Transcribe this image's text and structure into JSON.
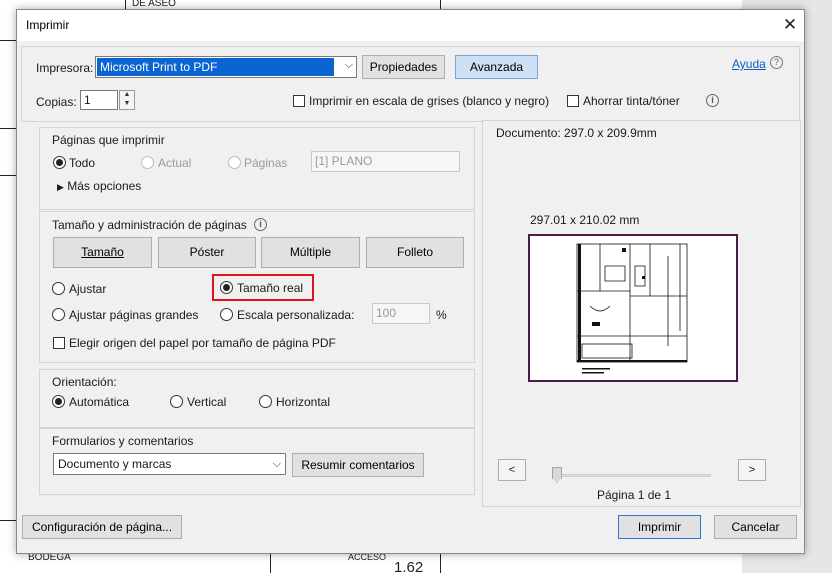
{
  "background": {
    "top_text": "DE ASEO",
    "bottom_left_text": "BODEGA",
    "bottom_mid_text": "ACCESO",
    "bottom_number": "1.62"
  },
  "dialog": {
    "title": "Imprimir",
    "close_glyph": "✕",
    "printer_label": "Impresora:",
    "printer_value": "Microsoft Print to PDF",
    "properties_button": "Propiedades",
    "advanced_button": "Avanzada",
    "help_link": "Ayuda",
    "copies_label": "Copias:",
    "copies_value": "1",
    "grayscale_label": "Imprimir en escala de grises (blanco y negro)",
    "save_ink_label": "Ahorrar tinta/tóner"
  },
  "pages_section": {
    "title": "Páginas que imprimir",
    "all_label": "Todo",
    "current_label": "Actual",
    "pages_label": "Páginas",
    "pages_value": "[1] PLANO",
    "more_options": "Más opciones"
  },
  "sizing_section": {
    "title": "Tamaño y administración de páginas",
    "tabs": [
      "Tamaño",
      "Póster",
      "Múltiple",
      "Folleto"
    ],
    "fit_label": "Ajustar",
    "actual_size_label": "Tamaño real",
    "shrink_label": "Ajustar páginas grandes",
    "custom_scale_label": "Escala personalizada:",
    "custom_scale_value": "100",
    "percent": "%",
    "paper_source_label": "Elegir origen del papel por tamaño de página PDF"
  },
  "orientation_section": {
    "title": "Orientación:",
    "auto_label": "Automática",
    "portrait_label": "Vertical",
    "landscape_label": "Horizontal"
  },
  "forms_section": {
    "title": "Formularios y comentarios",
    "select_value": "Documento y marcas",
    "summarize_button": "Resumir comentarios"
  },
  "preview": {
    "document_size": "Documento: 297.0 x 209.9mm",
    "page_size": "297.01 x 210.02 mm",
    "prev_glyph": "<",
    "next_glyph": ">",
    "page_indicator": "Página 1 de 1"
  },
  "footer": {
    "page_setup_button": "Configuración de página...",
    "print_button": "Imprimir",
    "cancel_button": "Cancelar"
  },
  "colors": {
    "accent": "#0a64d2",
    "highlight_box": "#e0141e",
    "preview_border": "#4b1a47"
  }
}
